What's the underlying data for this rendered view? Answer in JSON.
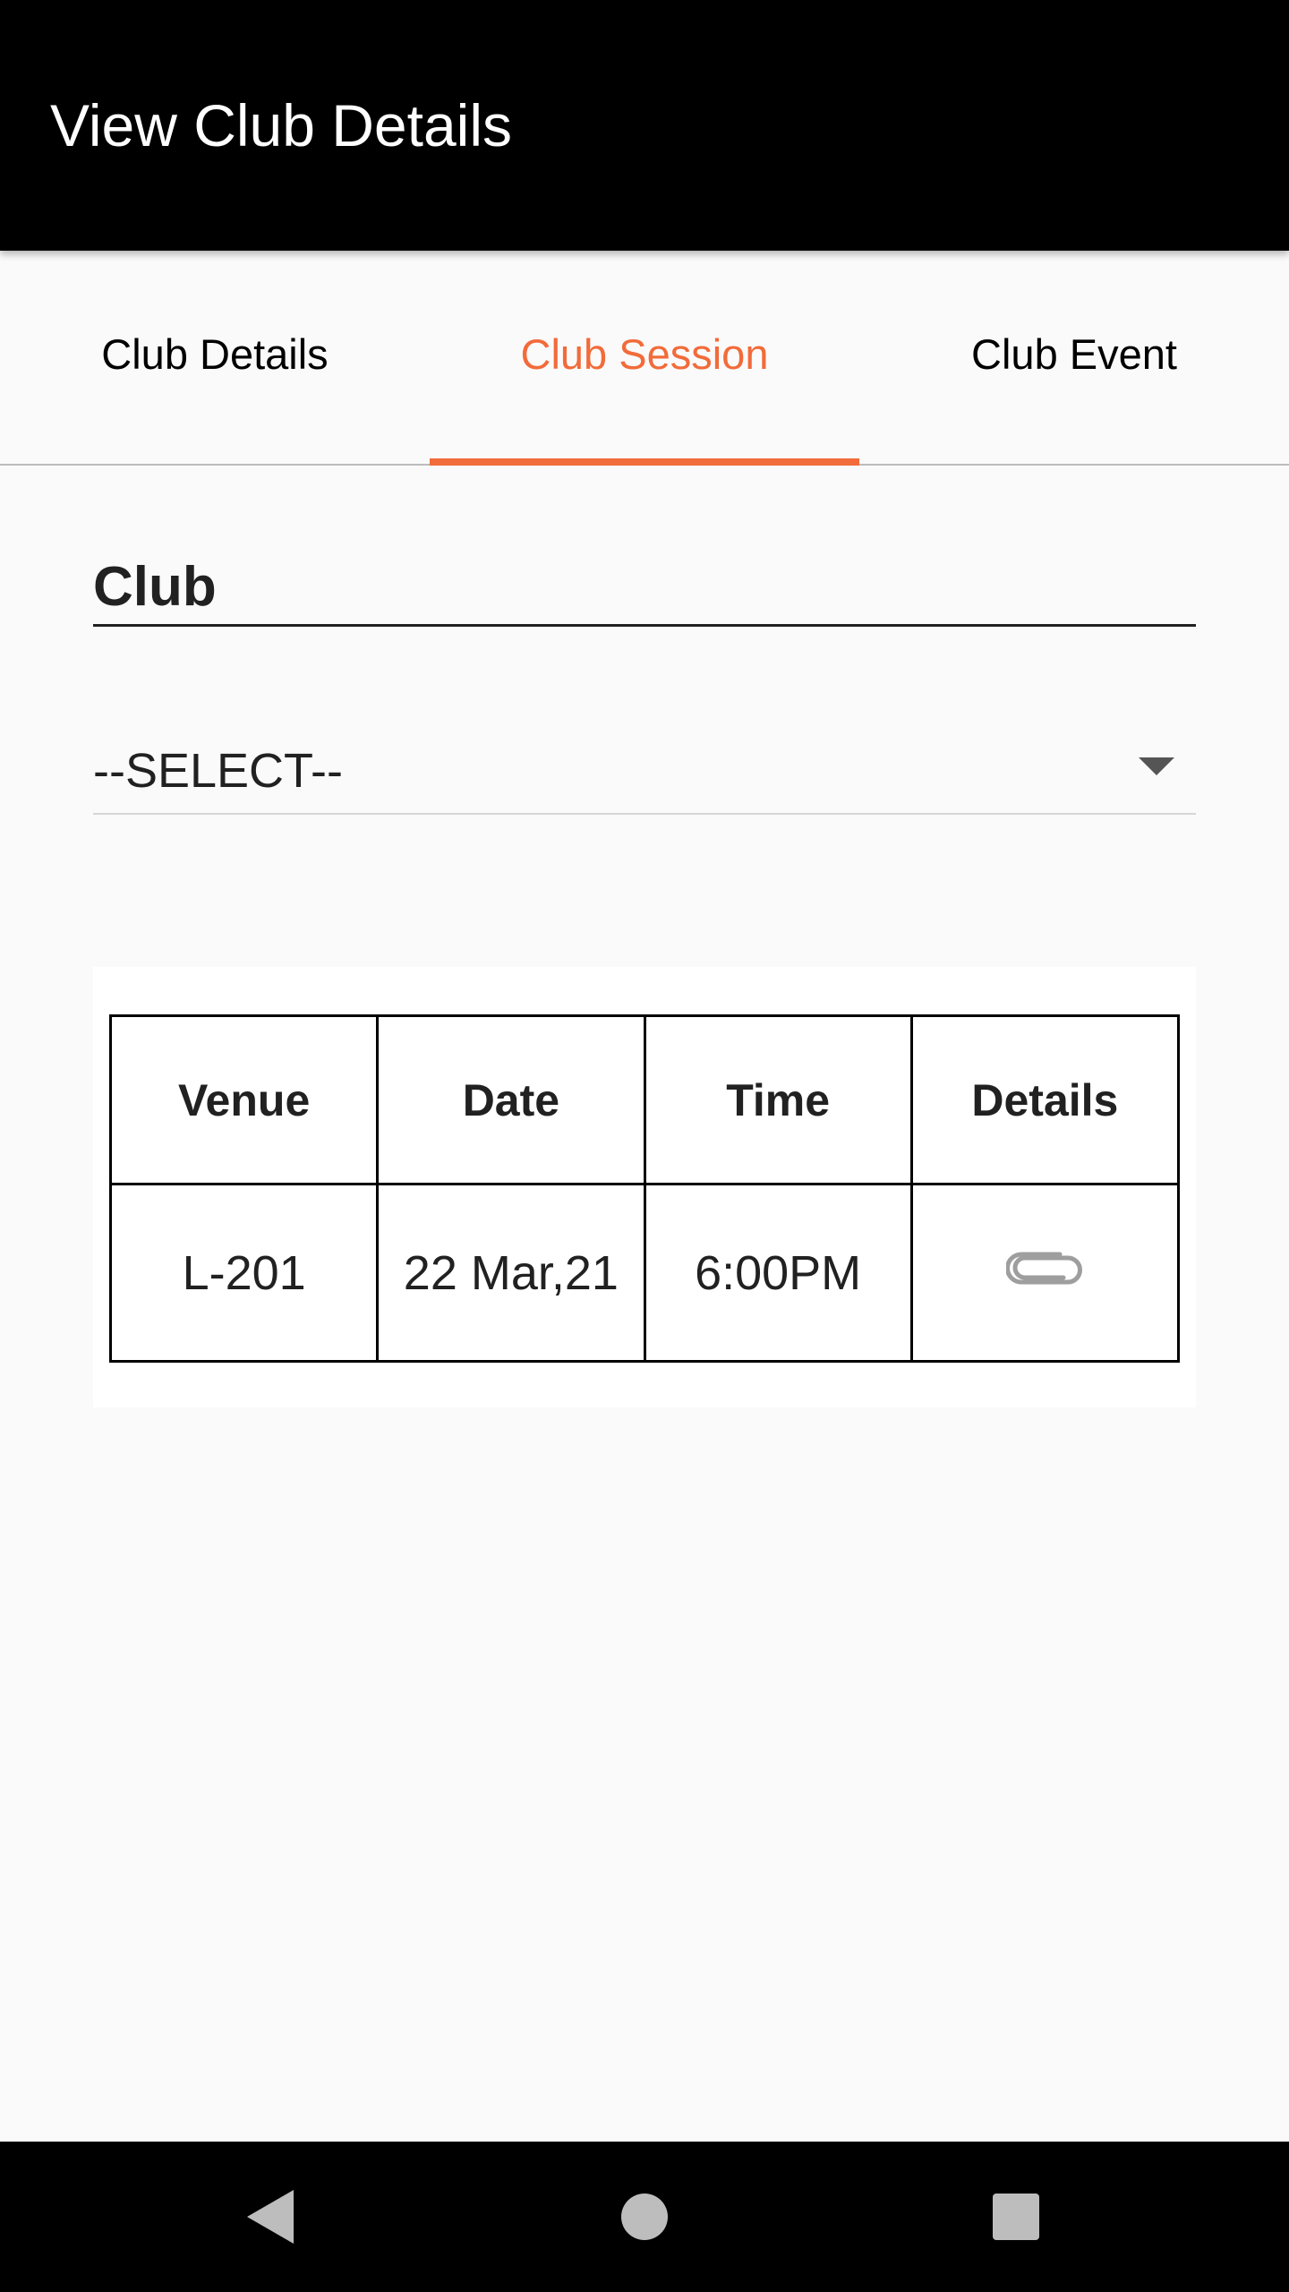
{
  "app_bar": {
    "title": "View Club Details"
  },
  "tabs": [
    {
      "label": "Club Details",
      "active": false
    },
    {
      "label": "Club Session",
      "active": true
    },
    {
      "label": "Club Event",
      "active": false
    }
  ],
  "form": {
    "section_label": "Club",
    "club_select": {
      "selected": "--SELECT--"
    }
  },
  "sessions_table": {
    "headers": [
      "Venue",
      "Date",
      "Time",
      "Details"
    ],
    "rows": [
      {
        "venue": "L-201",
        "date": "22 Mar,21",
        "time": "6:00PM",
        "details_icon": "paperclip-icon"
      }
    ]
  },
  "navigation": {
    "back_icon": "back-triangle-icon",
    "home_icon": "home-circle-icon",
    "recents_icon": "recents-square-icon"
  },
  "colors": {
    "accent": "#f26b3a",
    "app_bar_bg": "#000000",
    "background": "#fafafa"
  }
}
